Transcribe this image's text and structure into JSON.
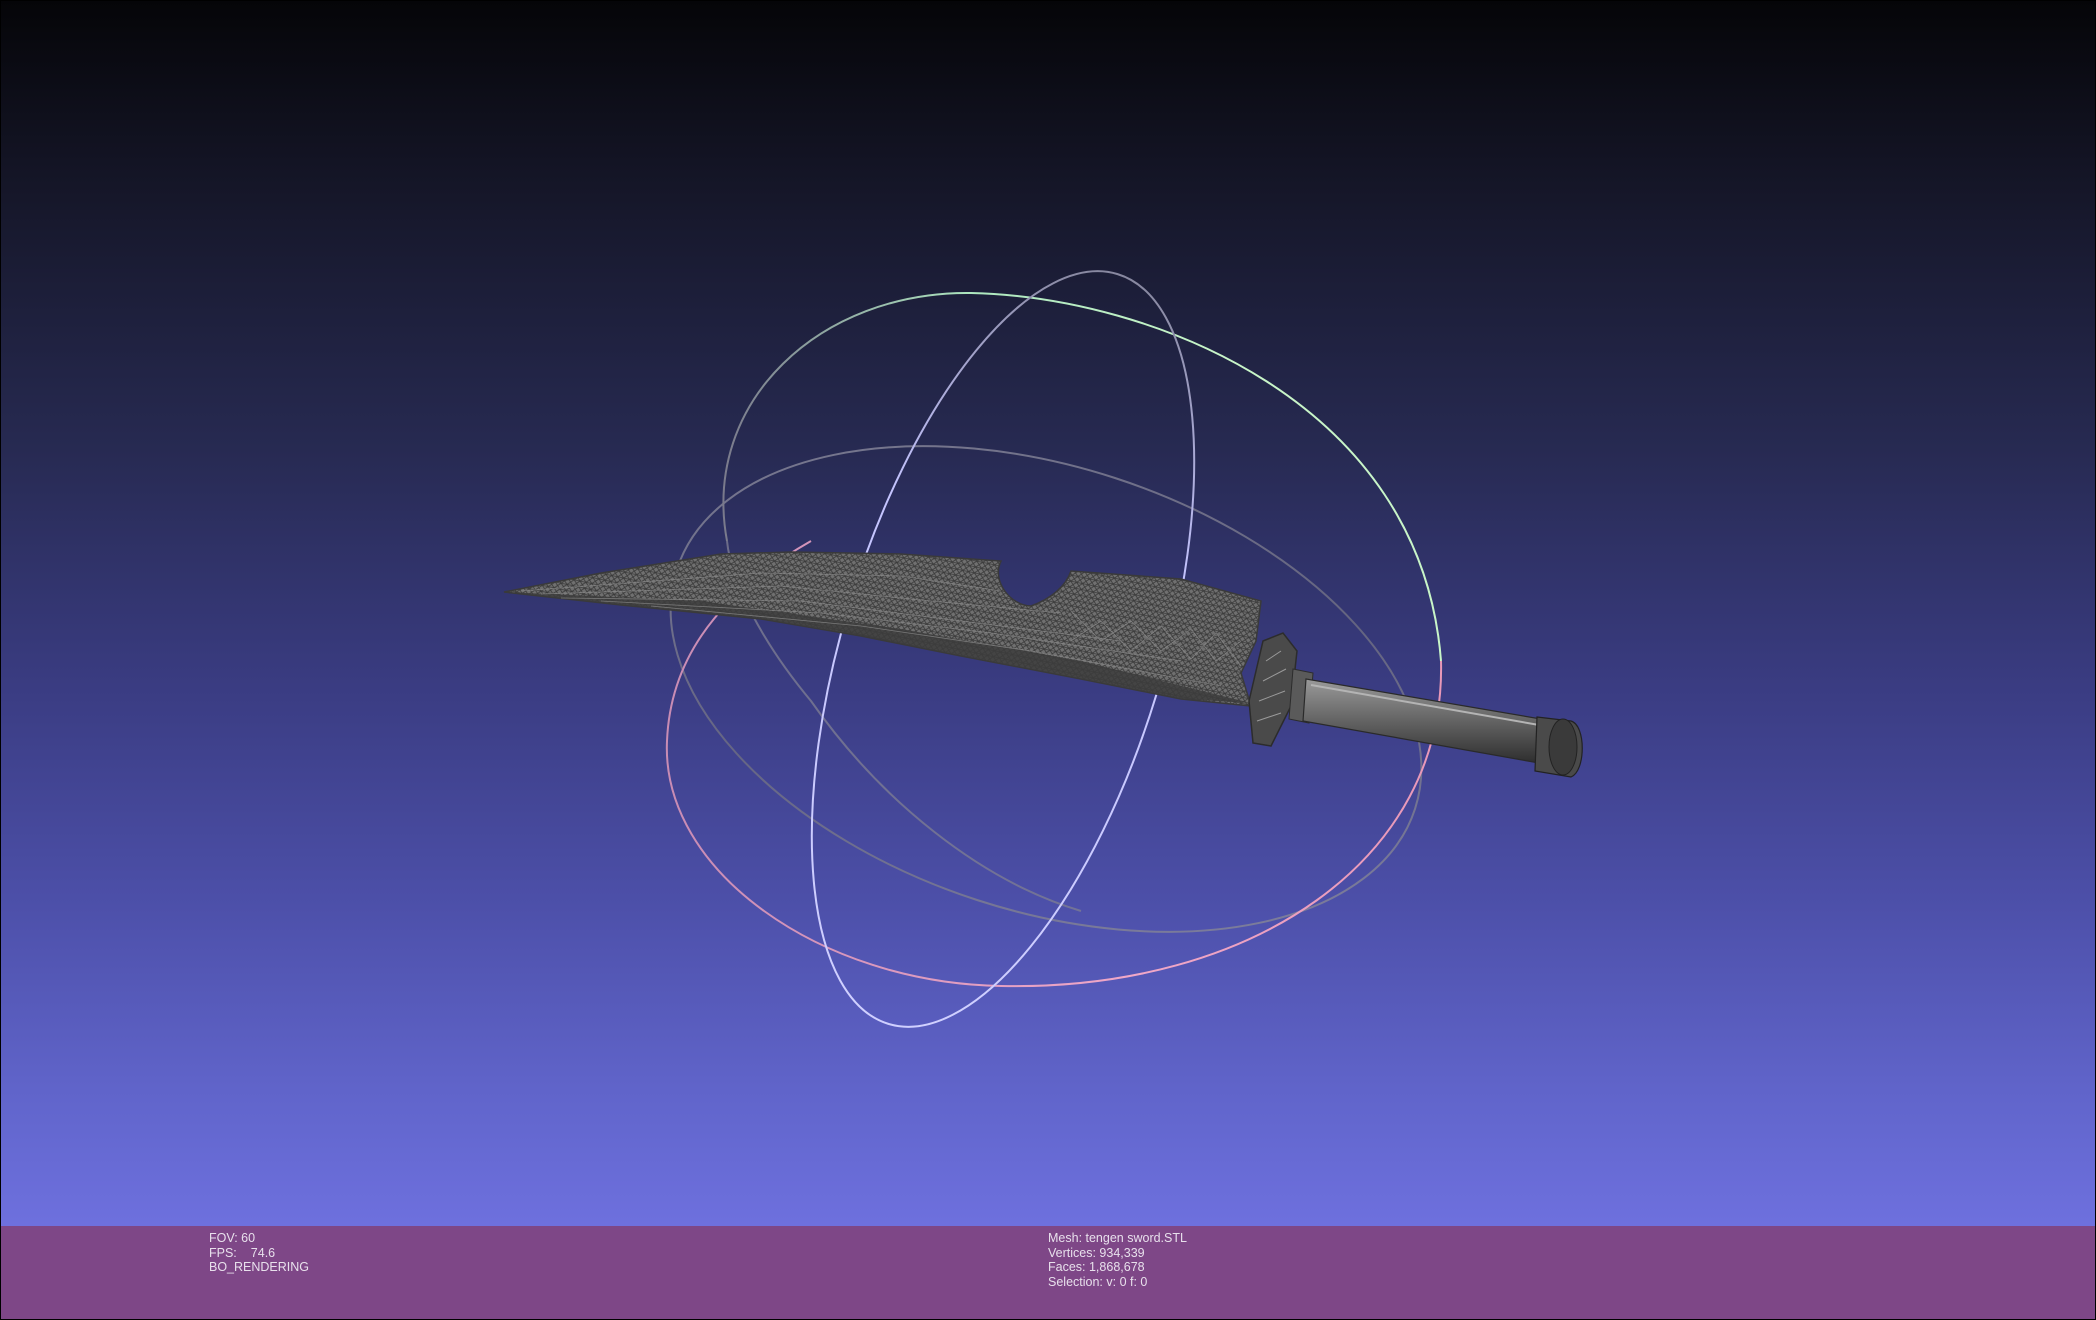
{
  "viewer": {
    "background_top": "#050508",
    "background_bottom": "#7778eb",
    "info_bar_color": "#7e4787",
    "mesh_color": "#555555",
    "trackball": {
      "x_ring_color": "#e8a0c0",
      "y_ring_color": "#a0f0b8",
      "z_ring_color": "#b8b8ff"
    }
  },
  "info_left": {
    "fov": "FOV: 60",
    "fps_label": "FPS:",
    "fps_value": "74.6",
    "render_mode": "BO_RENDERING"
  },
  "info_right": {
    "mesh": "Mesh: tengen sword.STL",
    "vertices": "Vertices: 934,339",
    "faces": "Faces: 1,868,678",
    "selection": "Selection: v: 0 f: 0"
  }
}
